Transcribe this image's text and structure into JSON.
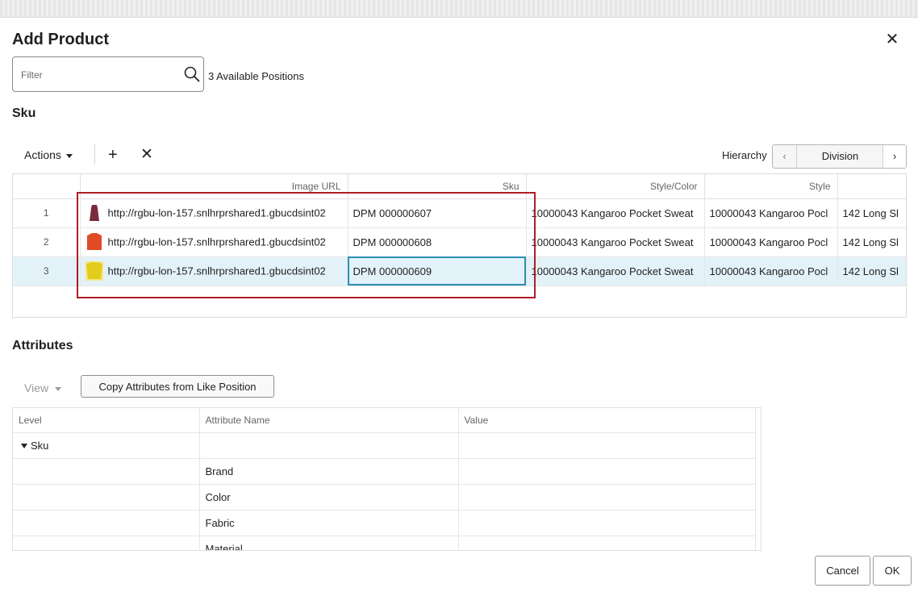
{
  "dialog": {
    "title": "Add Product",
    "close_icon": "close-icon"
  },
  "filter": {
    "placeholder": "Filter",
    "value": "",
    "available_text": "3 Available Positions"
  },
  "sku_section": {
    "heading": "Sku",
    "toolbar": {
      "actions_label": "Actions",
      "add_icon": "plus-icon",
      "remove_icon": "x-icon"
    },
    "hierarchy": {
      "label": "Hierarchy",
      "value": "Division"
    },
    "columns": [
      "",
      "Image URL",
      "Sku",
      "Style/Color",
      "Style",
      ""
    ],
    "rows": [
      {
        "num": "1",
        "image_url": "http://rgbu-lon-157.snlhrprshared1.gbucdsint02",
        "sku": "DPM 000000607",
        "style_color": "10000043 Kangaroo Pocket Sweat",
        "style": "10000043 Kangaroo Pocl",
        "extra": "142 Long Sl",
        "thumb_color": "#7a2c3a"
      },
      {
        "num": "2",
        "image_url": "http://rgbu-lon-157.snlhrprshared1.gbucdsint02",
        "sku": "DPM 000000608",
        "style_color": "10000043 Kangaroo Pocket Sweat",
        "style": "10000043 Kangaroo Pocl",
        "extra": "142 Long Sl",
        "thumb_color": "#e04a26"
      },
      {
        "num": "3",
        "image_url": "http://rgbu-lon-157.snlhrprshared1.gbucdsint02",
        "sku": "DPM 000000609",
        "style_color": "10000043 Kangaroo Pocket Sweat",
        "style": "10000043 Kangaroo Pocl",
        "extra": "142 Long Sl",
        "thumb_color": "#e3cc1c"
      }
    ],
    "selected_row": 3
  },
  "attributes_section": {
    "heading": "Attributes",
    "view_label": "View",
    "copy_button": "Copy Attributes from Like Position",
    "columns": [
      "Level",
      "Attribute Name",
      "Value"
    ],
    "group": "Sku",
    "rows": [
      "Brand",
      "Color",
      "Fabric",
      "Material"
    ]
  },
  "footer": {
    "cancel": "Cancel",
    "ok": "OK"
  },
  "colors": {
    "highlight_box": "#b01c25",
    "selected_row": "#e3f2f9",
    "focus_outline": "#2c8fb0"
  }
}
